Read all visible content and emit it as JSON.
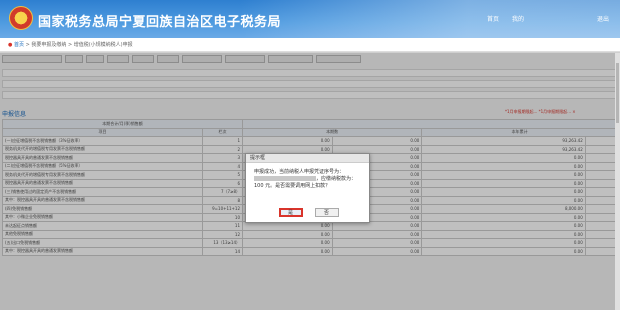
{
  "header": {
    "title": "国家税务总局宁夏回族自治区电子税务局",
    "emblem_char": "税",
    "nav": [
      "首页",
      "我的",
      "退出"
    ]
  },
  "breadcrumb": {
    "home": "首页",
    "path": " > 我要申报及缴纳 > 增值税(小规模纳税人)申报"
  },
  "section": {
    "title": "申报信息",
    "red_note": "*1月申报期限起... *1月申报期限起... ×"
  },
  "table": {
    "head1": "本期合计/月(季)销售额",
    "head2": "项目",
    "head3": "栏次",
    "head4": "本期数",
    "head5": "本年累计",
    "rows": [
      {
        "label": "(一)应征增值税不含税销售额（3%征收率）",
        "col": "1",
        "v1": "0.00",
        "v2": "0.00",
        "v3": "93,263.42"
      },
      {
        "label": "税务机关代开的增值税专用发票不含税销售额",
        "col": "2",
        "v1": "0.00",
        "v2": "0.00",
        "v3": "93,263.42"
      },
      {
        "label": "税控器具开具的普通发票不含税销售额",
        "col": "3",
        "v1": "0.00",
        "v2": "0.00",
        "v3": "0.00"
      },
      {
        "label": "(二)应征增值税不含税销售额（5%征收率）",
        "col": "4",
        "v1": "0.00",
        "v2": "0.00",
        "v3": "0.00"
      },
      {
        "label": "税务机关代开的增值税专用发票不含税销售额",
        "col": "5",
        "v1": "0.00",
        "v2": "0.00",
        "v3": "0.00"
      },
      {
        "label": "税控器具开具的普通发票不含税销售额",
        "col": "6",
        "v1": "0.00",
        "v2": "0.00",
        "v3": "0.00"
      },
      {
        "label": "(三)销售使用过的固定资产不含税销售额",
        "col": "7（7≥8）",
        "v1": "0.00",
        "v2": "0.00",
        "v3": "0.00"
      },
      {
        "label": "其中：税控器具开具的普通发票不含税销售额",
        "col": "8",
        "v1": "0.00",
        "v2": "0.00",
        "v3": "0.00"
      },
      {
        "label": "(四)免税销售额",
        "col": "9=10+11+12",
        "v1": "0.00",
        "v2": "0.00",
        "v3": "8,000.00"
      },
      {
        "label": "其中：小微企业免税销售额",
        "col": "10",
        "v1": "0.00",
        "v2": "0.00",
        "v3": "0.00"
      },
      {
        "label": "未达起征点销售额",
        "col": "11",
        "v1": "0.00",
        "v2": "0.00",
        "v3": "0.00"
      },
      {
        "label": "其他免税销售额",
        "col": "12",
        "v1": "0.00",
        "v2": "0.00",
        "v3": "0.00"
      },
      {
        "label": "(五)出口免税销售额",
        "col": "13（13≥14）",
        "v1": "0.00",
        "v2": "0.00",
        "v3": "0.00"
      },
      {
        "label": "其中：税控器具开具的普通发票销售额",
        "col": "14",
        "v1": "0.00",
        "v2": "0.00",
        "v3": "0.00"
      }
    ]
  },
  "dialog": {
    "title": "提示框",
    "line1": "申报成功，当前纳税人申报凭证序号为：",
    "line2": "，应缴纳税款为：",
    "line3": "100 元。是否需要调用网上扣款？",
    "ok": "是",
    "cancel": "否"
  }
}
